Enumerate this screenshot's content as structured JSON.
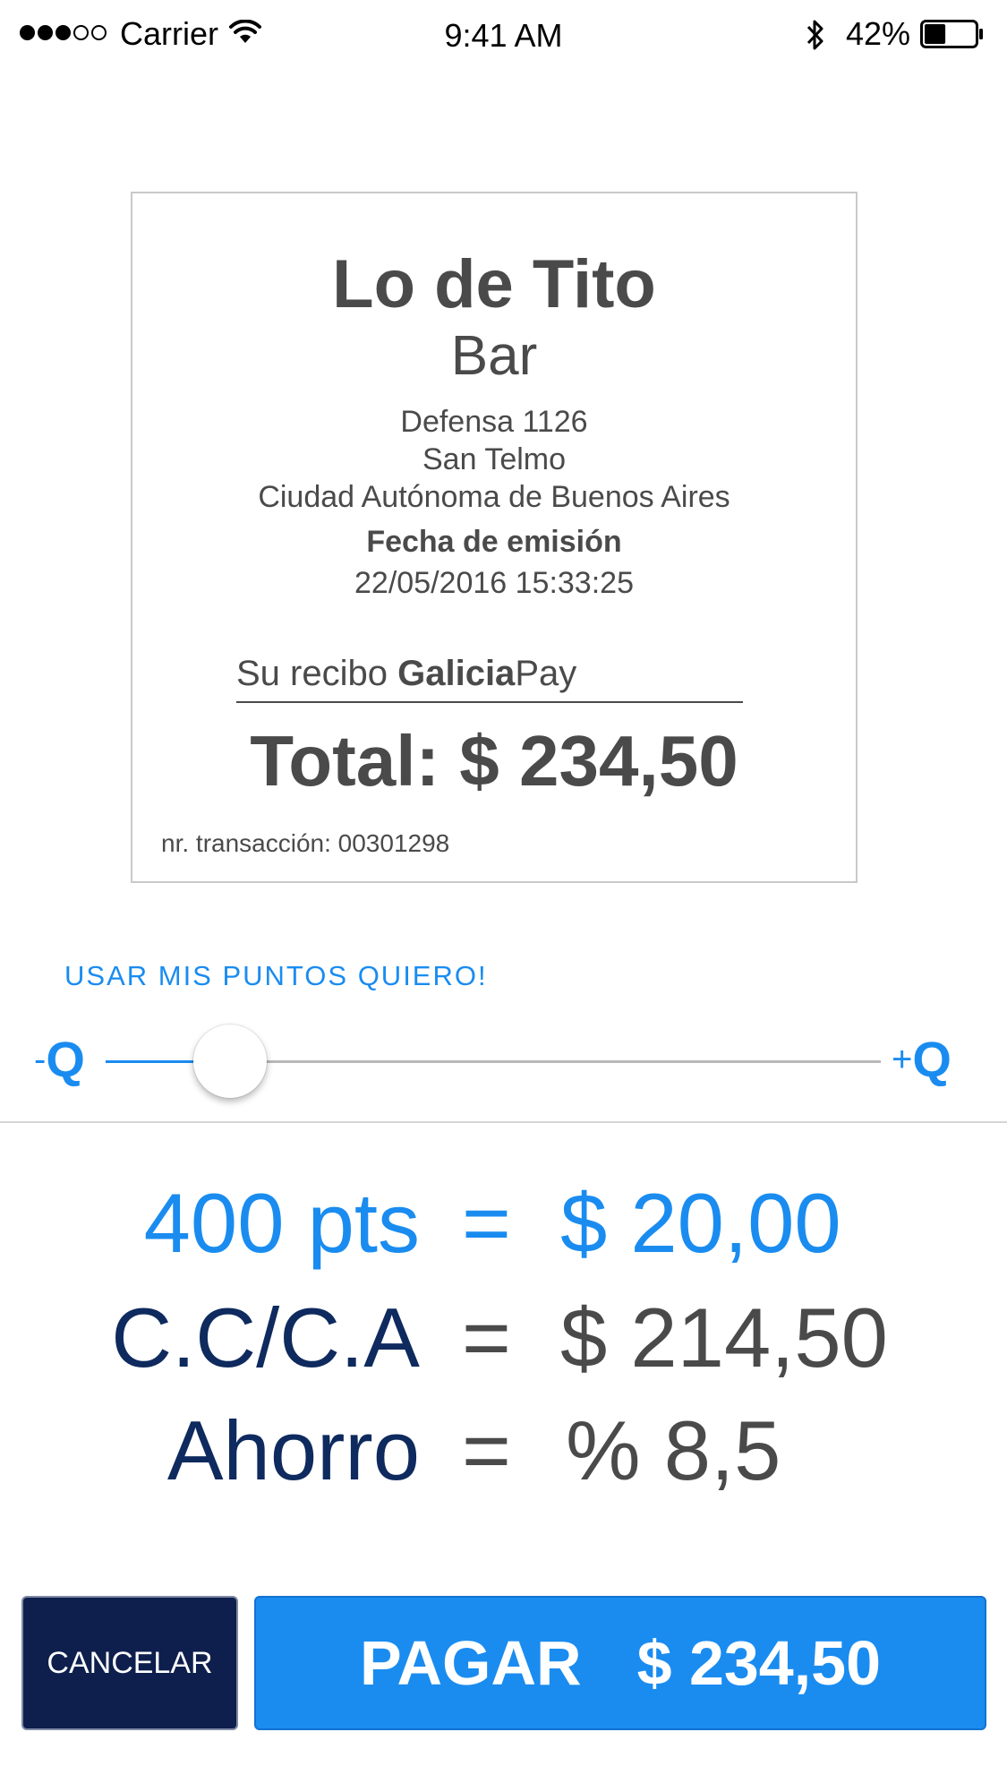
{
  "status_bar": {
    "carrier": "Carrier",
    "time": "9:41 AM",
    "battery_percent": "42%",
    "battery_level": 0.42,
    "signal_bars_filled": 3,
    "signal_bars_total": 5
  },
  "receipt": {
    "merchant_name": "Lo de Tito",
    "merchant_type": "Bar",
    "address_line_1": "Defensa 1126",
    "address_line_2": "San Telmo",
    "address_line_3": "Ciudad Autónoma de Buenos Aires",
    "date_label": "Fecha de emisión",
    "date_value": "22/05/2016 15:33:25",
    "receipt_prefix": "Su recibo ",
    "brand_bold": "Galicia",
    "brand_regular": "Pay",
    "total": "Total: $ 234,50",
    "transaction": "nr. transacción: 00301298"
  },
  "points": {
    "title": "USAR MIS PUNTOS QUIERO!",
    "min_sign": "-",
    "min_label": "Q",
    "max_sign": "+",
    "max_label": "Q",
    "slider_value": 0.16
  },
  "summary": {
    "points_label": "400 pts",
    "points_eq": "=",
    "points_value": "$ 20,00",
    "account_label": "C.C/C.A",
    "account_eq": "=",
    "account_value": "$ 214,50",
    "savings_label": "Ahorro",
    "savings_eq": "=",
    "savings_value": "% 8,5"
  },
  "actions": {
    "cancel_label": "CANCELAR",
    "pay_label": "PAGAR",
    "pay_amount": "$ 234,50"
  },
  "colors": {
    "accent_blue": "#1a8cf0",
    "dark_navy": "#0e1f4d",
    "text_gray": "#4a4a4a"
  }
}
